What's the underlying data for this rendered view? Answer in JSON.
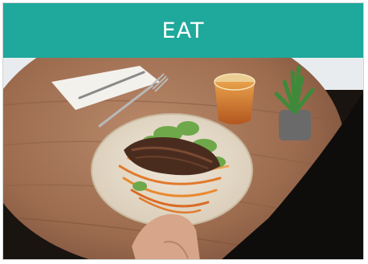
{
  "header": {
    "title": "EAT",
    "background_color": "#1fa89c",
    "text_color": "#ffffff"
  },
  "photo": {
    "icon": "food-plate-photo"
  }
}
